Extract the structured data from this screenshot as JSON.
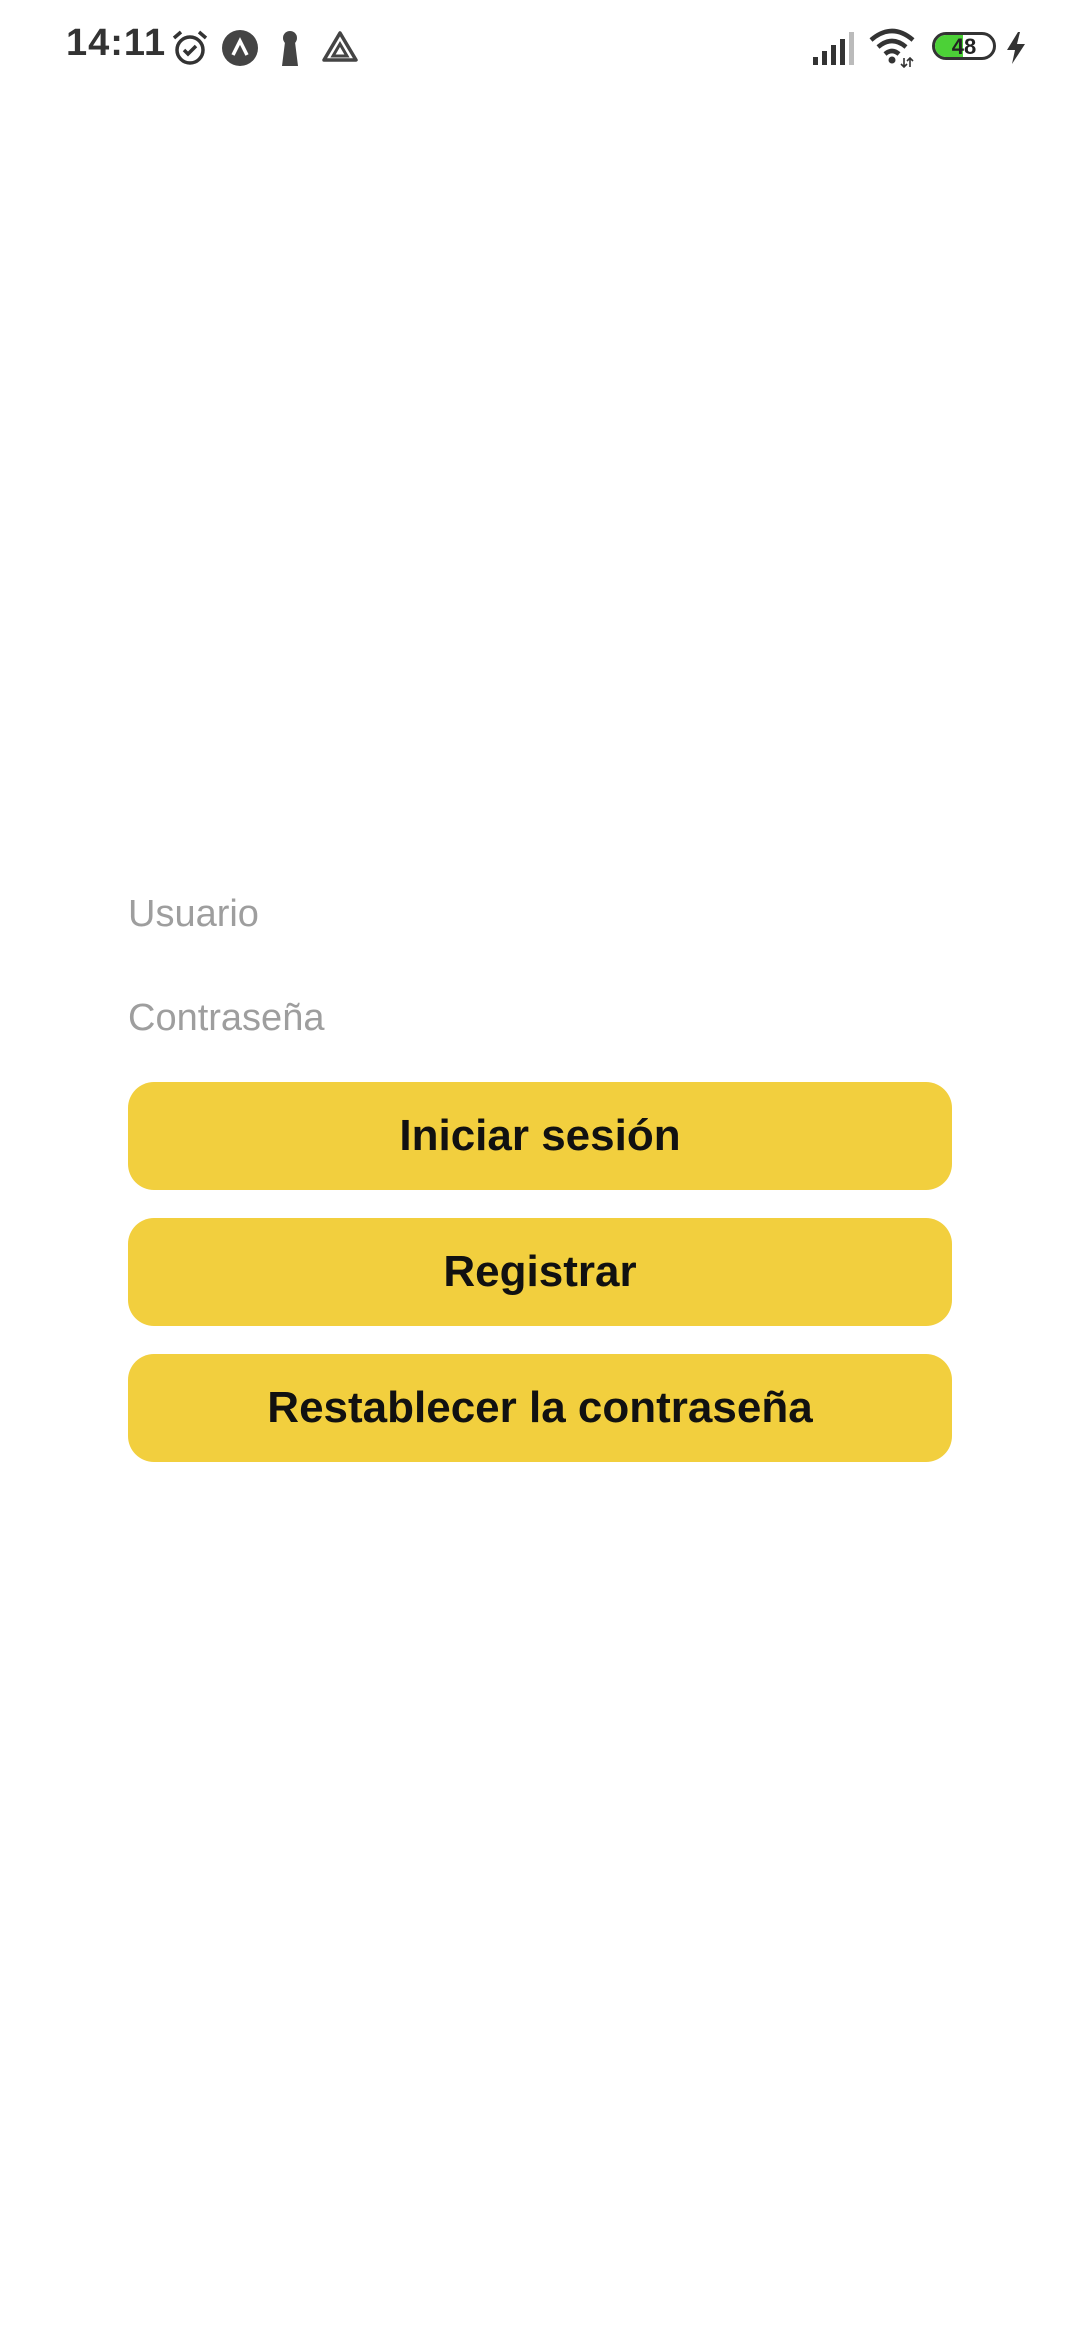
{
  "status_bar": {
    "time": "14:11",
    "battery_level": "48",
    "battery_fraction": 0.48,
    "left_icons": [
      "alarm-icon",
      "app-a-icon",
      "keyhole-icon",
      "drive-icon"
    ],
    "right_icons": [
      "signal-icon",
      "wifi-icon",
      "battery-icon",
      "charging-icon"
    ],
    "icon_color": "#333333",
    "battery_color": "#4cd137"
  },
  "login": {
    "username_placeholder": "Usuario",
    "username_value": "",
    "password_placeholder": "Contraseña",
    "password_value": "",
    "login_label": "Iniciar sesión",
    "register_label": "Registrar",
    "reset_label": "Restablecer la contraseña",
    "button_color": "#f2cf3e",
    "placeholder_color": "#9e9e9e"
  }
}
